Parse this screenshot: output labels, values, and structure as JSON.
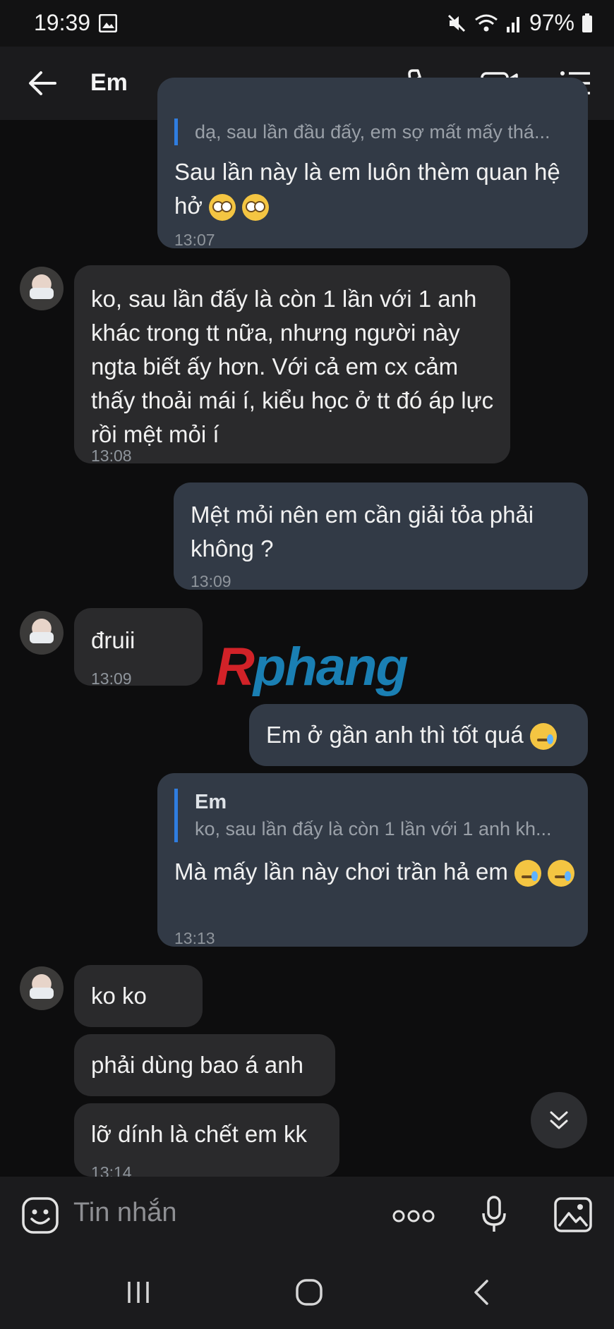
{
  "status": {
    "time": "19:39",
    "battery": "97%"
  },
  "header": {
    "title": "Em"
  },
  "messages": [
    {
      "quote_text": "dạ, sau lần đầu đấy, em sợ mất mấy thá...",
      "text": "Sau lần này là em luôn thèm quan hệ hở",
      "time": "13:07"
    },
    {
      "text": "ko, sau lần đấy là còn 1 lần với 1 anh khác trong tt nữa, nhưng người này ngta biết ấy hơn. Với cả em cx cảm thấy thoải mái í, kiểu học ở tt đó áp lực rồi mệt mỏi í",
      "time": "13:08"
    },
    {
      "text": "Mệt mỏi nên em cần giải tỏa phải không ?",
      "time": "13:09"
    },
    {
      "text": "đruii",
      "time": "13:09"
    },
    {
      "text": "Em ở gần anh thì tốt quá"
    },
    {
      "quote_name": "Em",
      "quote_text": "ko, sau lần đấy là còn 1 lần với 1 anh kh...",
      "text": "Mà mấy lần này chơi trần hả em",
      "time": "13:13"
    },
    {
      "text": "ko ko"
    },
    {
      "text": "phải dùng bao á anh"
    },
    {
      "text": "lỡ dính là chết em kk",
      "time": "13:14"
    }
  ],
  "watermark": {
    "first": "R",
    "rest": "phang"
  },
  "composer": {
    "placeholder": "Tin nhắn"
  },
  "icons": [
    "back-arrow-icon",
    "phone-icon",
    "video-icon",
    "menu-icon",
    "emoji-icon",
    "more-icon",
    "mic-icon",
    "gallery-icon",
    "chevron-down-icon"
  ]
}
